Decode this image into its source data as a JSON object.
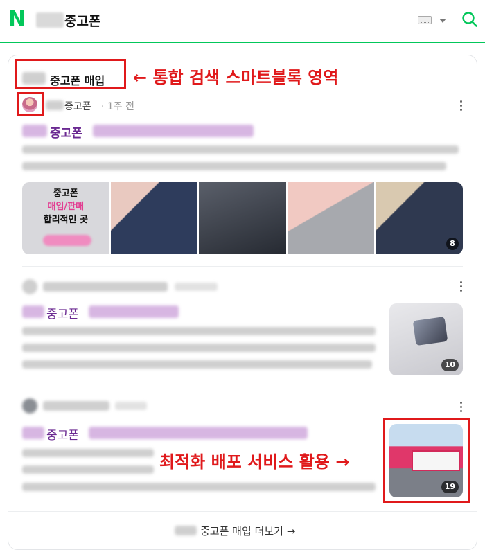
{
  "header": {
    "logo": "N",
    "query": "중고폰",
    "icons": [
      "keyboard-icon",
      "chevron-down-icon",
      "search-icon"
    ],
    "accent_color": "#03c75a"
  },
  "block": {
    "title": "중고폰 매입",
    "more_link": "중고폰 매입 더보기 →"
  },
  "annotations": {
    "top": "← 통합 검색 스마트블록 영역",
    "bottom": "최적화 배포 서비스 활용 →",
    "color": "#e0191b"
  },
  "posts": [
    {
      "author": "중고폰",
      "date": "· 1주 전",
      "title_keyword": "중고폰",
      "images": [
        {
          "line1": "중고폰",
          "line2": "매입/판매",
          "line3": "합리적인 곳"
        }
      ],
      "image_count": "8"
    },
    {
      "title_keyword": "중고폰",
      "image_count": "10"
    },
    {
      "title_keyword": "중고폰",
      "image_count": "19"
    }
  ]
}
